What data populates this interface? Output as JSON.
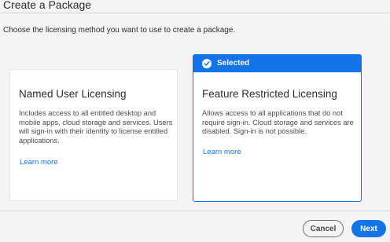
{
  "header": {
    "title": "Create a Package"
  },
  "subtitle": "Choose the licensing method you want to use to create a package.",
  "cards": [
    {
      "title": "Named User Licensing",
      "description": "Includes access to all entitled desktop and mobile apps, cloud storage and services. Users will sign-in with their identity to license entitled applications.",
      "link": "Learn more",
      "selected": false
    },
    {
      "title": "Feature Restricted Licensing",
      "description": "Allows access to all applications that do not require sign-in. Cloud storage and services are disabled. Sign-in is not possible.",
      "link": "Learn more",
      "selected": true,
      "badge": "Selected",
      "badge_icon": "checkmark-circle-icon"
    }
  ],
  "footer": {
    "cancel_label": "Cancel",
    "next_label": "Next"
  },
  "colors": {
    "accent": "#1473e6",
    "background": "#f4f4f4",
    "card": "#ffffff"
  }
}
